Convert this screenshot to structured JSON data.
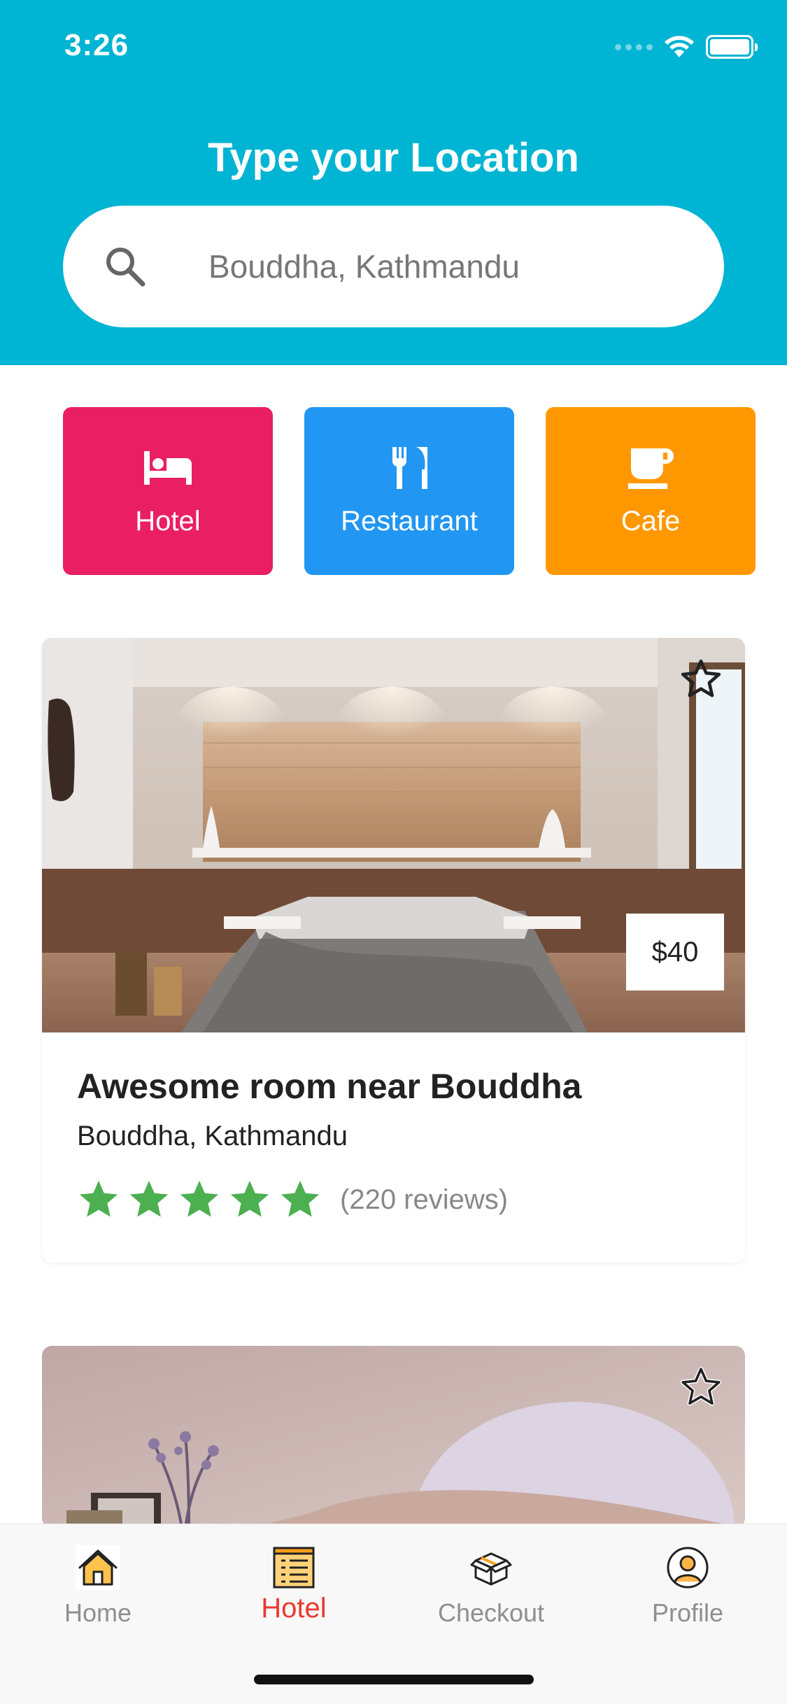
{
  "status_bar": {
    "time": "3:26",
    "icons": [
      "signal-icon",
      "wifi-icon",
      "battery-icon"
    ]
  },
  "header": {
    "title": "Type your Location",
    "search": {
      "value": "Bouddha, Kathmandu",
      "placeholder": "Type your Location",
      "icon": "search-icon"
    },
    "background_color": "#00b4d3"
  },
  "categories": [
    {
      "label": "Hotel",
      "icon": "bed-icon",
      "color": "#ea1f63"
    },
    {
      "label": "Restaurant",
      "icon": "cutlery-icon",
      "color": "#2196f3"
    },
    {
      "label": "Cafe",
      "icon": "coffee-cup-icon",
      "color": "#ff9800"
    }
  ],
  "listings": [
    {
      "title": "Awesome room near Bouddha",
      "location": "Bouddha, Kathmandu",
      "price": "$40",
      "rating": 5,
      "reviews": "(220 reviews)",
      "favorite_icon": "star-outline-icon",
      "rating_color": "#4caf50"
    },
    {
      "favorite_icon": "star-outline-icon"
    }
  ],
  "bottom_nav": {
    "items": [
      {
        "label": "Home",
        "icon": "home-icon"
      },
      {
        "label": "Hotel",
        "icon": "hotel-list-icon",
        "active": true
      },
      {
        "label": "Checkout",
        "icon": "box-icon"
      },
      {
        "label": "Profile",
        "icon": "user-circle-icon"
      }
    ],
    "active_color": "#ea3a2e"
  }
}
